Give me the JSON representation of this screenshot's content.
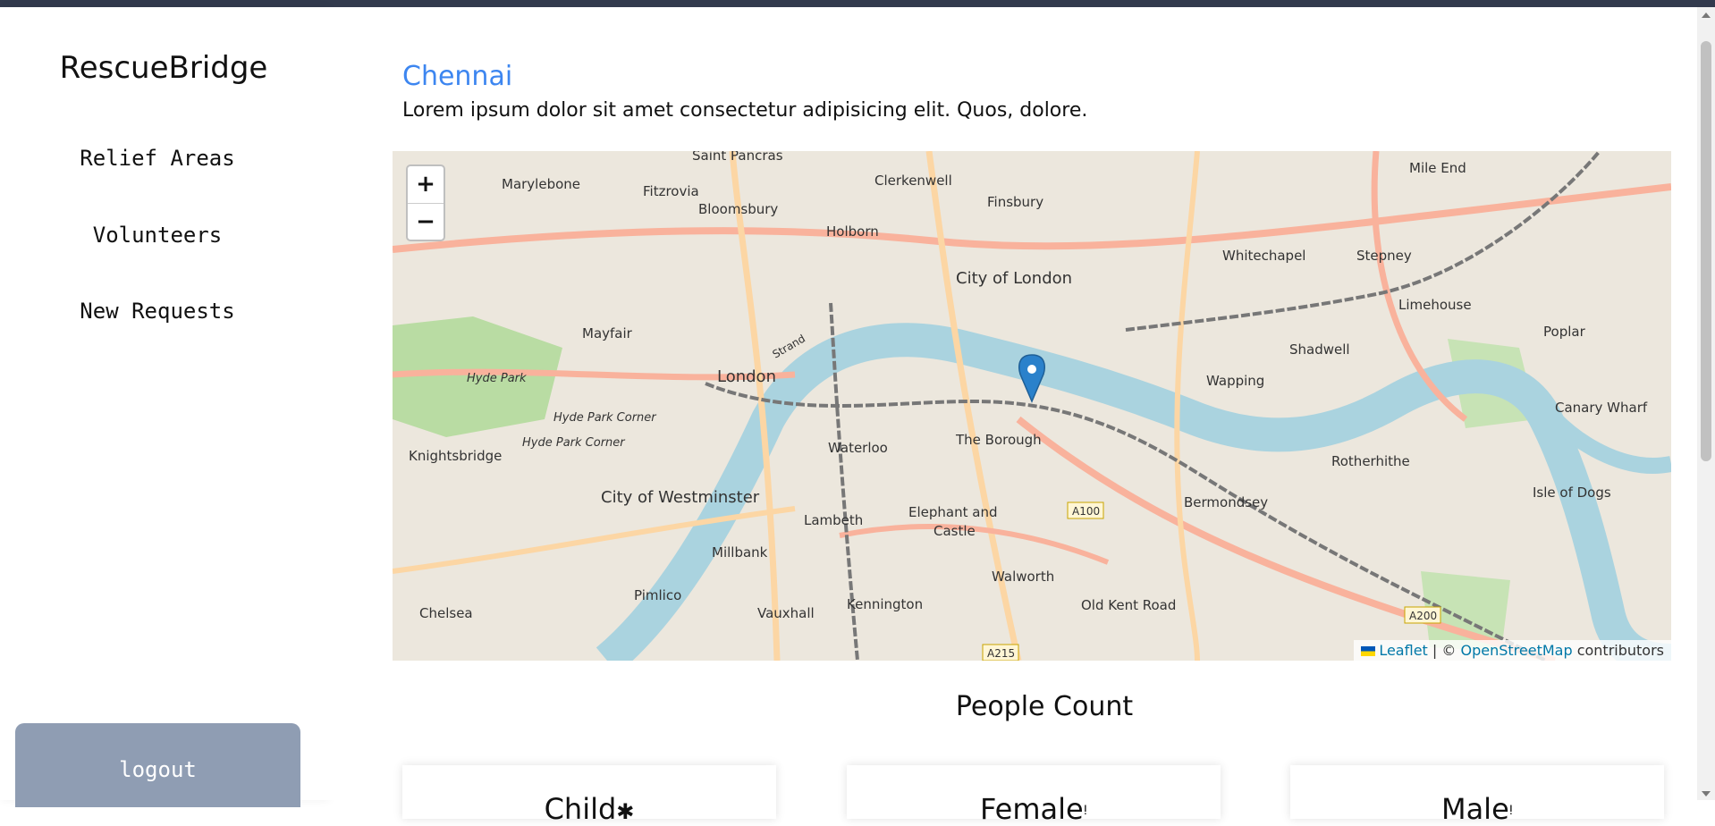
{
  "sidebar": {
    "brand": "RescueBridge",
    "items": [
      {
        "label": "Relief Areas"
      },
      {
        "label": "Volunteers"
      },
      {
        "label": "New Requests"
      }
    ],
    "logout_label": "logout"
  },
  "main": {
    "city": "Chennai",
    "description": "Lorem ipsum dolor sit amet consectetur adipisicing elit. Quos, dolore.",
    "map": {
      "zoom_in": "+",
      "zoom_out": "−",
      "attribution_leaflet": "Leaflet",
      "attribution_sep": "| ©",
      "attribution_osm": "OpenStreetMap",
      "attribution_tail": "contributors",
      "labels": [
        "Saint Pancras",
        "Marylebone",
        "Fitzrovia",
        "Bloomsbury",
        "Clerkenwell",
        "Finsbury",
        "Holborn",
        "Mile End",
        "Whitechapel",
        "Stepney",
        "City of London",
        "Limehouse",
        "Mayfair",
        "Hyde Park",
        "London",
        "Strand",
        "Shadwell",
        "Poplar",
        "Wapping",
        "Hyde Park Corner",
        "Hyde Park Corner",
        "Knightsbridge",
        "Waterloo",
        "The Borough",
        "Canary Wharf",
        "Rotherhithe",
        "Bermondsey",
        "City of Westminster",
        "Lambeth",
        "Elephant and Castle",
        "A100",
        "Isle of Dogs",
        "Millbank",
        "Walworth",
        "Pimlico",
        "Chelsea",
        "Kennington",
        "Vauxhall",
        "Old Kent Road",
        "A200",
        "A215"
      ]
    },
    "people_count_title": "People Count",
    "cards": [
      {
        "label": "Child",
        "icon": "child-icon"
      },
      {
        "label": "Female",
        "icon": "female-icon"
      },
      {
        "label": "Male",
        "icon": "male-icon"
      }
    ]
  },
  "colors": {
    "accent": "#3d86f0",
    "logout_bg": "#8f9db3",
    "topbar": "#323a4d",
    "marker": "#2a81cb"
  }
}
